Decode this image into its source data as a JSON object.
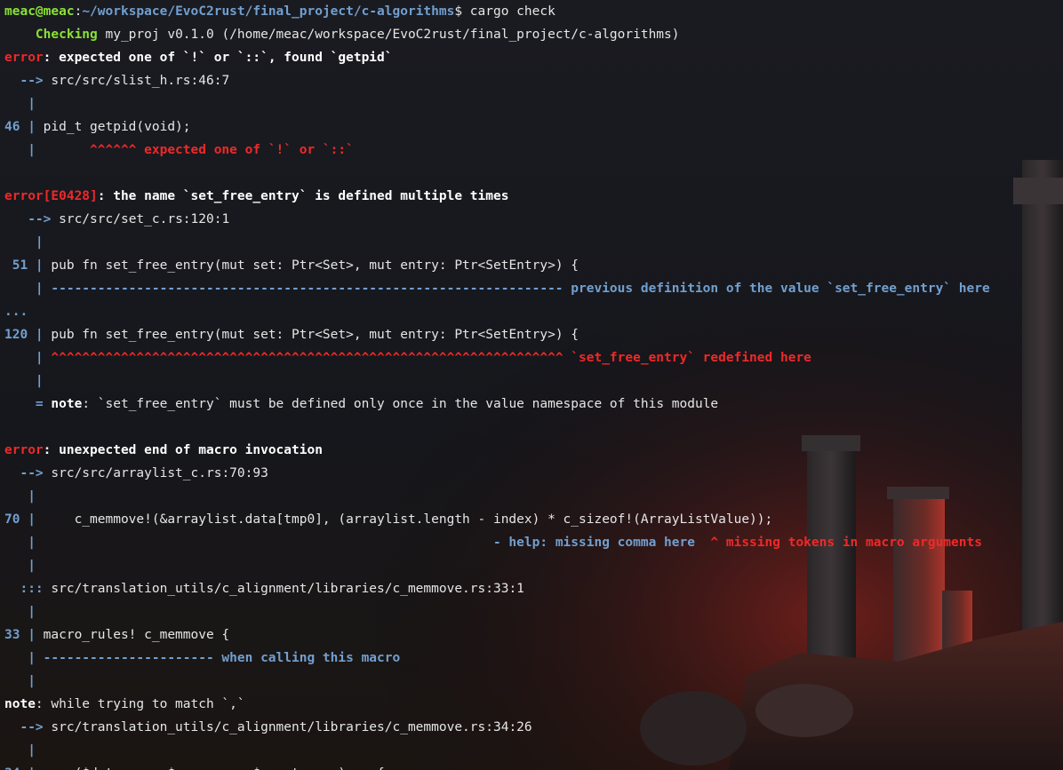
{
  "colors": {
    "default": "#e6e6e6",
    "prompt_user": "#8ae234",
    "prompt_path": "#729fcf",
    "error_red": "#ef2929",
    "gutter_blue": "#729fcf",
    "checking_green": "#8ae234",
    "white_bold": "#ffffff"
  },
  "terminal": {
    "lines": [
      [
        {
          "t": "meac@meac",
          "c": "prompt_user",
          "b": true
        },
        {
          "t": ":",
          "c": "default"
        },
        {
          "t": "~/workspace/EvoC2rust/final_project/c-algorithms",
          "c": "prompt_path",
          "b": true
        },
        {
          "t": "$ cargo check",
          "c": "default"
        }
      ],
      [
        {
          "t": "    Checking",
          "c": "checking_green",
          "b": true
        },
        {
          "t": " my_proj v0.1.0 (/home/meac/workspace/EvoC2rust/final_project/c-algorithms)",
          "c": "default"
        }
      ],
      [
        {
          "t": "error",
          "c": "error_red",
          "b": true
        },
        {
          "t": ": expected one of `!` or `::`, found `getpid`",
          "c": "white_bold",
          "b": true
        }
      ],
      [
        {
          "t": "  -->",
          "c": "gutter_blue",
          "b": true
        },
        {
          "t": " src/src/slist_h.rs:46:7",
          "c": "default"
        }
      ],
      [
        {
          "t": "   |",
          "c": "gutter_blue",
          "b": true
        }
      ],
      [
        {
          "t": "46 |",
          "c": "gutter_blue",
          "b": true
        },
        {
          "t": " pid_t getpid(void);",
          "c": "default"
        }
      ],
      [
        {
          "t": "   |",
          "c": "gutter_blue",
          "b": true
        },
        {
          "t": "       ^^^^^^ expected one of `!` or `::`",
          "c": "error_red",
          "b": true
        }
      ],
      [],
      [
        {
          "t": "error[E0428]",
          "c": "error_red",
          "b": true
        },
        {
          "t": ": the name `set_free_entry` is defined multiple times",
          "c": "white_bold",
          "b": true
        }
      ],
      [
        {
          "t": "   -->",
          "c": "gutter_blue",
          "b": true
        },
        {
          "t": " src/src/set_c.rs:120:1",
          "c": "default"
        }
      ],
      [
        {
          "t": "    |",
          "c": "gutter_blue",
          "b": true
        }
      ],
      [
        {
          "t": " 51 |",
          "c": "gutter_blue",
          "b": true
        },
        {
          "t": " pub fn set_free_entry(mut set: Ptr<Set>, mut entry: Ptr<SetEntry>) {",
          "c": "default"
        }
      ],
      [
        {
          "t": "    | ------------------------------------------------------------------ previous definition of the value `set_free_entry` here",
          "c": "gutter_blue",
          "b": true
        }
      ],
      [
        {
          "t": "...",
          "c": "gutter_blue",
          "b": true
        }
      ],
      [
        {
          "t": "120 |",
          "c": "gutter_blue",
          "b": true
        },
        {
          "t": " pub fn set_free_entry(mut set: Ptr<Set>, mut entry: Ptr<SetEntry>) {",
          "c": "default"
        }
      ],
      [
        {
          "t": "    |",
          "c": "gutter_blue",
          "b": true
        },
        {
          "t": " ^^^^^^^^^^^^^^^^^^^^^^^^^^^^^^^^^^^^^^^^^^^^^^^^^^^^^^^^^^^^^^^^^^ `set_free_entry` redefined here",
          "c": "error_red",
          "b": true
        }
      ],
      [
        {
          "t": "    |",
          "c": "gutter_blue",
          "b": true
        }
      ],
      [
        {
          "t": "    =",
          "c": "gutter_blue",
          "b": true
        },
        {
          "t": " note",
          "c": "white_bold",
          "b": true
        },
        {
          "t": ": `set_free_entry` must be defined only once in the value namespace of this module",
          "c": "default"
        }
      ],
      [],
      [
        {
          "t": "error",
          "c": "error_red",
          "b": true
        },
        {
          "t": ": unexpected end of macro invocation",
          "c": "white_bold",
          "b": true
        }
      ],
      [
        {
          "t": "  -->",
          "c": "gutter_blue",
          "b": true
        },
        {
          "t": " src/src/arraylist_c.rs:70:93",
          "c": "default"
        }
      ],
      [
        {
          "t": "   |",
          "c": "gutter_blue",
          "b": true
        }
      ],
      [
        {
          "t": "70 |",
          "c": "gutter_blue",
          "b": true
        },
        {
          "t": "     c_memmove!(&arraylist.data[tmp0], (arraylist.length - index) * c_sizeof!(ArrayListValue));",
          "c": "default"
        }
      ],
      [
        {
          "t": "   |",
          "c": "gutter_blue",
          "b": true
        },
        {
          "t": "                                                           - help: missing comma here",
          "c": "gutter_blue",
          "b": true
        },
        {
          "t": "  ^ missing tokens in macro arguments",
          "c": "error_red",
          "b": true
        }
      ],
      [
        {
          "t": "   |",
          "c": "gutter_blue",
          "b": true
        }
      ],
      [
        {
          "t": "  :::",
          "c": "gutter_blue",
          "b": true
        },
        {
          "t": " src/translation_utils/c_alignment/libraries/c_memmove.rs:33:1",
          "c": "default"
        }
      ],
      [
        {
          "t": "   |",
          "c": "gutter_blue",
          "b": true
        }
      ],
      [
        {
          "t": "33 |",
          "c": "gutter_blue",
          "b": true
        },
        {
          "t": " macro_rules! c_memmove {",
          "c": "default"
        }
      ],
      [
        {
          "t": "   | ---------------------- when calling this macro",
          "c": "gutter_blue",
          "b": true
        }
      ],
      [
        {
          "t": "   |",
          "c": "gutter_blue",
          "b": true
        }
      ],
      [
        {
          "t": "note",
          "c": "white_bold",
          "b": true
        },
        {
          "t": ": while trying to match `,`",
          "c": "default"
        }
      ],
      [
        {
          "t": "  -->",
          "c": "gutter_blue",
          "b": true
        },
        {
          "t": " src/translation_utils/c_alignment/libraries/c_memmove.rs:34:26",
          "c": "default"
        }
      ],
      [
        {
          "t": "   |",
          "c": "gutter_blue",
          "b": true
        }
      ],
      [
        {
          "t": "34 |",
          "c": "gutter_blue",
          "b": true
        },
        {
          "t": "     ($dst:expr, $src:expr, $count:expr) => {",
          "c": "default"
        }
      ]
    ]
  }
}
